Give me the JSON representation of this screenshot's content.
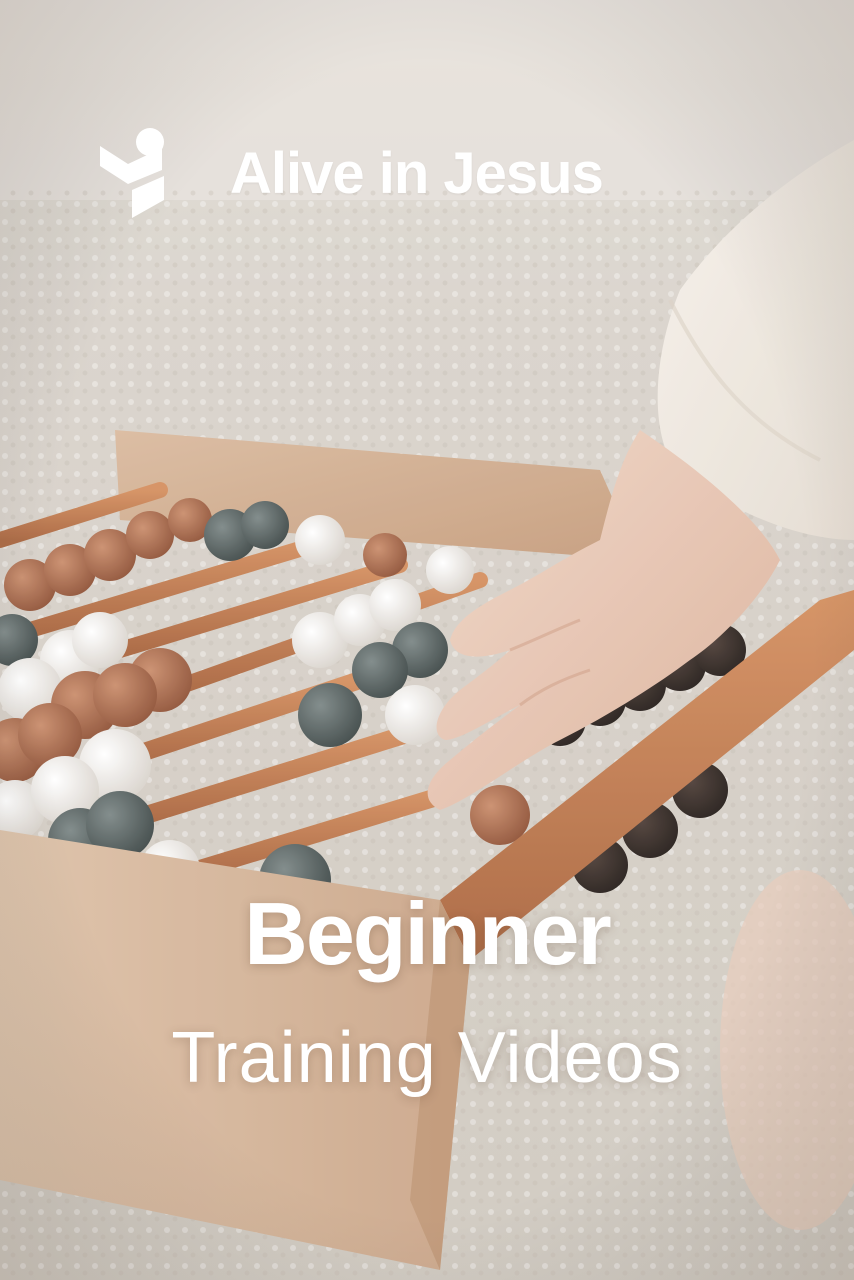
{
  "brand": {
    "name": "Alive in Jesus",
    "logo_icon": "sprout-person-icon",
    "text_color": "#ffffff"
  },
  "headline": {
    "main": "Beginner",
    "sub": "Training Videos"
  },
  "photo": {
    "icon": "abacus-photo"
  }
}
